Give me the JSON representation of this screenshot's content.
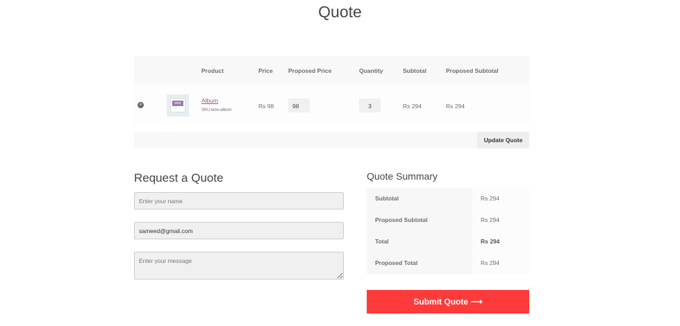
{
  "page_title": "Quote",
  "table": {
    "headers": [
      "Product",
      "Price",
      "Proposed Price",
      "Quantity",
      "Subtotal",
      "Proposed Subtotal"
    ],
    "row": {
      "product": "Album",
      "sku": "SKU:woo-album",
      "price": "Rs 98",
      "proposed_price": "98",
      "quantity": "3",
      "subtotal": "Rs 294",
      "proposed_subtotal": "Rs 294",
      "thumb_text": "woo"
    }
  },
  "update_label": "Update Quote",
  "form": {
    "heading": "Request a Quote",
    "name_placeholder": "Enter your name",
    "email_value": "sameed@gmail.com",
    "message_placeholder": "Enter your message"
  },
  "summary": {
    "heading": "Quote Summary",
    "rows": [
      {
        "label": "Subtotal",
        "value": "Rs 294"
      },
      {
        "label": "Proposed Subtotal",
        "value": "Rs 294"
      },
      {
        "label": "Total",
        "value": "Rs 294"
      },
      {
        "label": "Proposed Total",
        "value": "Rs 294"
      }
    ]
  },
  "submit_label": "Submit Quote",
  "submit_arrow": "⟶",
  "accent": "#ff3a3a"
}
